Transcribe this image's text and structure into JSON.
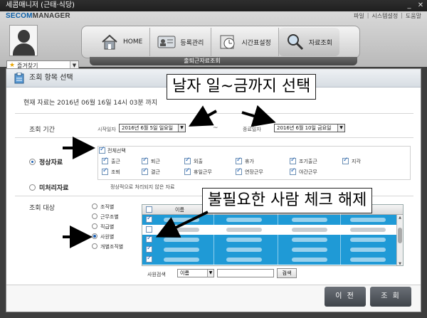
{
  "window": {
    "title": "세콤매니저 (근태·식당)"
  },
  "header": {
    "logo_prefix": "SECOM",
    "logo_suffix": "MANAGER",
    "links": [
      "파일",
      "시스템설정",
      "도움말"
    ],
    "favorites_label": "즐겨찾기",
    "nav": [
      {
        "label": "HOME",
        "icon": "home-icon"
      },
      {
        "label": "등록관리",
        "icon": "id-card-icon"
      },
      {
        "label": "시간표설정",
        "icon": "clock-icon"
      },
      {
        "label": "자료조회",
        "icon": "magnifier-icon",
        "active": true
      }
    ],
    "subtab": "출퇴근자료조회"
  },
  "panel": {
    "title": "조회 항목 선택",
    "current_data": "현재 자료는 2016년 06월 16일 14시 03분 까지",
    "period": {
      "label": "조회 기간",
      "start_label": "시작일자",
      "start_value": "2016년  6월  5일 일요일",
      "tilde": "~",
      "end_label": "종료일자",
      "end_value": "2016년  6월 10일 금요일"
    },
    "normal": {
      "label": "정상자료",
      "all_label": "전체선택",
      "items": [
        "출근",
        "퇴근",
        "외출",
        "휴가",
        "조기출근",
        "지각",
        "조퇴",
        "결근",
        "휴일근무",
        "연장근무",
        "야간근무"
      ]
    },
    "unprocessed": {
      "label": "미처리자료",
      "note": "정상적으로 처리되지 않은 자료"
    },
    "target": {
      "label": "조회 대상",
      "options": [
        "조직별",
        "근무조별",
        "직급별",
        "사원별",
        "개별조직별"
      ],
      "selected_index": 3
    },
    "table": {
      "header_name": "이름",
      "rows": [
        {
          "checked": true,
          "selected": true
        },
        {
          "checked": false,
          "selected": false
        },
        {
          "checked": true,
          "selected": true
        },
        {
          "checked": true,
          "selected": true
        },
        {
          "checked": true,
          "selected": true
        }
      ]
    },
    "search": {
      "label": "사원검색",
      "field": "이름",
      "button": "검색"
    },
    "buttons": {
      "prev": "이 전",
      "query": "조 회"
    }
  },
  "annotations": {
    "top": "날자 일~금까지 선택",
    "bottom": "불필요한 사람 체크 해제"
  }
}
